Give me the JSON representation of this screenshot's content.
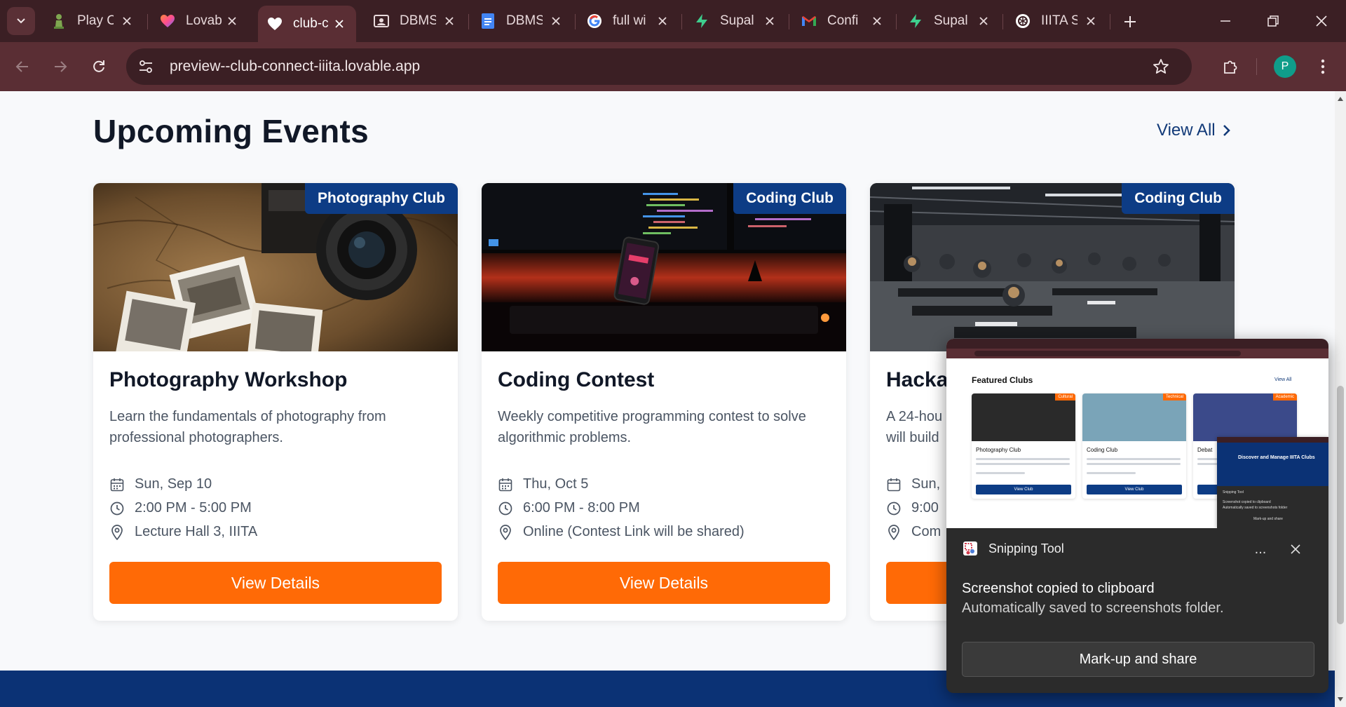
{
  "browser": {
    "tabs": [
      {
        "title": "Play C",
        "favicon": "chess-pawn-icon",
        "active": false
      },
      {
        "title": "Lovab",
        "favicon": "lovable-heart-icon",
        "active": false
      },
      {
        "title": "club-c",
        "favicon": "heart-icon",
        "active": true
      },
      {
        "title": "DBMS",
        "favicon": "classroom-icon",
        "active": false
      },
      {
        "title": "DBMS",
        "favicon": "docs-icon",
        "active": false
      },
      {
        "title": "full wi",
        "favicon": "google-icon",
        "active": false
      },
      {
        "title": "Supal",
        "favicon": "supabase-icon",
        "active": false
      },
      {
        "title": "Confi",
        "favicon": "gmail-icon",
        "active": false
      },
      {
        "title": "Supal",
        "favicon": "supabase-icon",
        "active": false
      },
      {
        "title": "IIITA S",
        "favicon": "openai-icon",
        "active": false
      }
    ],
    "url": "preview--club-connect-iiita.lovable.app",
    "profile_initial": "P"
  },
  "page": {
    "section_title": "Upcoming Events",
    "view_all_label": "View All",
    "events": [
      {
        "club": "Photography Club",
        "title": "Photography Workshop",
        "description": "Learn the fundamentals of photography from professional photographers.",
        "date": "Sun, Sep 10",
        "time": "2:00 PM - 5:00 PM",
        "location": "Lecture Hall 3, IIITA",
        "button": "View Details"
      },
      {
        "club": "Coding Club",
        "title": "Coding Contest",
        "description": "Weekly competitive programming contest to solve algorithmic problems.",
        "date": "Thu, Oct 5",
        "time": "6:00 PM - 8:00 PM",
        "location": "Online (Contest Link will be shared)",
        "button": "View Details"
      },
      {
        "club": "Coding Club",
        "title": "Hacka",
        "description": "A 24-hou will build",
        "date": "Sun,",
        "time": "9:00",
        "location": "Com",
        "button": "View Details"
      }
    ]
  },
  "snipping_tool": {
    "app_name": "Snipping Tool",
    "message_title": "Screenshot copied to clipboard",
    "message_body": "Automatically saved to screenshots folder.",
    "action_label": "Mark-up and share",
    "more_label": "...",
    "preview": {
      "heading": "Featured Clubs",
      "view_all": "View All",
      "clubs": [
        {
          "name": "Photography Club",
          "tag": "Cultural",
          "button": "View Club"
        },
        {
          "name": "Coding Club",
          "tag": "Technical",
          "button": "View Club"
        },
        {
          "name": "Debat",
          "tag": "Academic",
          "button": "View Club"
        }
      ],
      "overlay_title": "Discover and Manage IIITA Clubs",
      "overlay_tool": "Snipping Tool",
      "overlay_msg": "Screenshot copied to clipboard",
      "overlay_msg2": "Automatically saved to screenshots folder",
      "overlay_action": "Mark-up and share"
    }
  },
  "colors": {
    "tabstrip": "#3b1f24",
    "toolbar": "#5a2e34",
    "brand_navy": "#0d3c85",
    "accent_orange": "#ff6a06",
    "footer": "#0b3275"
  }
}
